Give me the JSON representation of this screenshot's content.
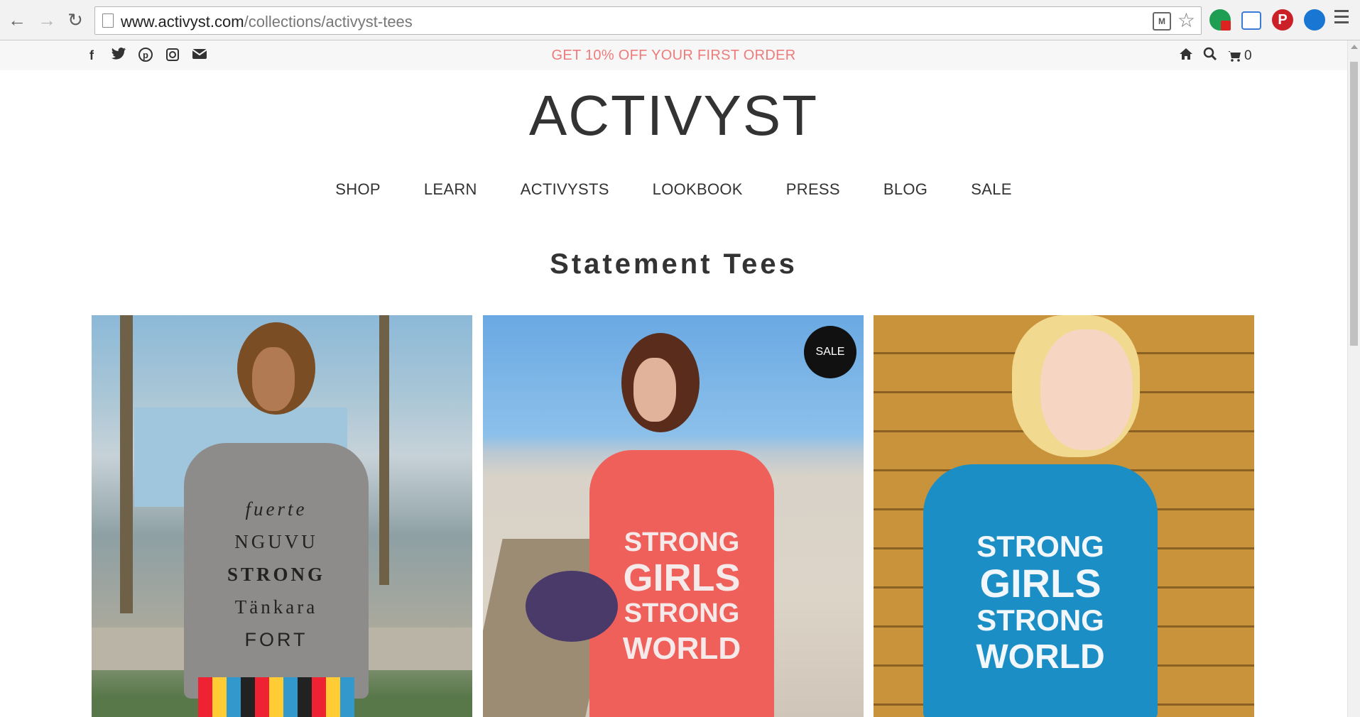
{
  "browser": {
    "url_domain": "www.activyst.com",
    "url_path": "/collections/activyst-tees",
    "back_icon": "arrow-left-icon",
    "forward_icon": "arrow-right-icon",
    "reload_icon": "reload-icon",
    "reader_icon_label": "M"
  },
  "topbar": {
    "promo": "GET 10% OFF YOUR FIRST ORDER",
    "social_icons": [
      "facebook-icon",
      "twitter-icon",
      "pinterest-icon",
      "instagram-icon",
      "email-icon"
    ],
    "cart_count": "0"
  },
  "header": {
    "logo": "ACTIVYST",
    "nav": [
      "SHOP",
      "LEARN",
      "ACTIVYSTS",
      "LOOKBOOK",
      "PRESS",
      "BLOG",
      "SALE"
    ]
  },
  "collection": {
    "title": "Statement Tees",
    "sale_badge": "SALE",
    "shirt_texts": {
      "p1": [
        "fuerte",
        "NGUVU",
        "STRONG",
        "Tänkara",
        "FORT"
      ],
      "p2": [
        "STRONG",
        "GIRLS",
        "STRONG",
        "WORLD"
      ],
      "p3": [
        "STRONG",
        "GIRLS",
        "STRONG",
        "WORLD"
      ]
    }
  },
  "colors": {
    "promo": "#ee7b7b",
    "text": "#333333"
  }
}
